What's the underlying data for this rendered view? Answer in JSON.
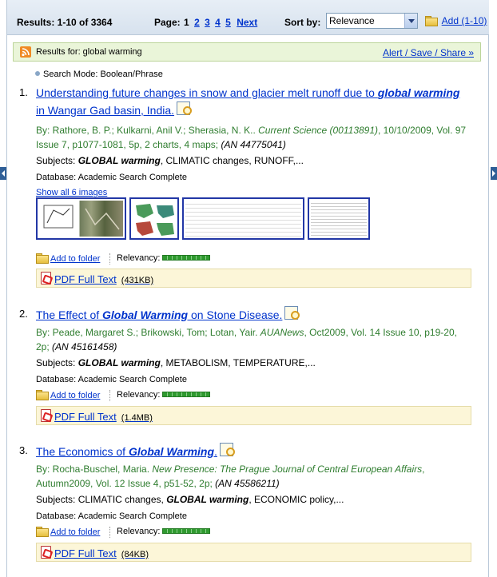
{
  "toolbar": {
    "results_count": "Results: 1-10 of 3364",
    "page_label": "Page:",
    "current_page": "1",
    "pages": [
      "2",
      "3",
      "4",
      "5"
    ],
    "next_label": "Next",
    "sort_label": "Sort by:",
    "sort_value": "Relevance",
    "add_label": "Add (1-10)"
  },
  "results_for": {
    "label": "Results for:",
    "term": "global warming",
    "alert_link": "Alert / Save / Share »"
  },
  "search_mode": "Search Mode: Boolean/Phrase",
  "results": [
    {
      "num": "1.",
      "title_pre": "Understanding future changes in snow and glacier melt runoff due to ",
      "title_em": "global warming",
      "title_post": " in Wangar Gad basin, India.",
      "authors": "By: Rathore, B. P.; Kulkarni, Anil V.; Sherasia, N. K.. ",
      "source": "Current Science (00113891)",
      "details": ", 10/10/2009, Vol. 97 Issue 7, p1077-1081, 5p, 2 charts, 4 maps; ",
      "an": "(AN 44775041)",
      "subjects_label": "Subjects: ",
      "subjects_pre": "",
      "subjects_em": "GLOBAL warming",
      "subjects_post": ", CLIMATIC changes, RUNOFF,...",
      "database": "Database: Academic Search Complete",
      "show_images": "Show all 6 images",
      "add_folder": "Add to folder",
      "relevancy": "Relevancy:",
      "pdf_label": "PDF Full Text",
      "pdf_size": "(431KB)"
    },
    {
      "num": "2.",
      "title_pre": "The Effect of ",
      "title_em": "Global Warming",
      "title_post": " on Stone Disease.",
      "authors": "By: Peade, Margaret S.; Brikowski, Tom; Lotan, Yair. ",
      "source": "AUANews",
      "details": ", Oct2009, Vol. 14 Issue 10, p19-20, 2p; ",
      "an": "(AN 45161458)",
      "subjects_label": "Subjects: ",
      "subjects_pre": "",
      "subjects_em": "GLOBAL warming",
      "subjects_post": ", METABOLISM, TEMPERATURE,...",
      "database": "Database: Academic Search Complete",
      "add_folder": "Add to folder",
      "relevancy": "Relevancy:",
      "pdf_label": "PDF Full Text",
      "pdf_size": "(1.4MB)"
    },
    {
      "num": "3.",
      "title_pre": "The Economics of ",
      "title_em": "Global Warming",
      "title_post": ".",
      "authors": "By: Rocha-Buschel, Maria. ",
      "source": "New Presence: The Prague Journal of Central European Affairs",
      "details": ", Autumn2009, Vol. 12 Issue 4, p51-52, 2p; ",
      "an": "(AN 45586211)",
      "subjects_label": "Subjects: ",
      "subjects_pre": "CLIMATIC changes, ",
      "subjects_em": "GLOBAL warming",
      "subjects_post": ", ECONOMIC policy,...",
      "database": "Database: Academic Search Complete",
      "add_folder": "Add to folder",
      "relevancy": "Relevancy:",
      "pdf_label": "PDF Full Text",
      "pdf_size": "(84KB)"
    }
  ],
  "colors": {
    "link": "#0033cc",
    "byline": "#2f7d2f",
    "results_bar_bg": "#eaf5d9",
    "pdf_bar_bg": "#fcf6d8",
    "toolbar_bg": "#dde7f2"
  }
}
